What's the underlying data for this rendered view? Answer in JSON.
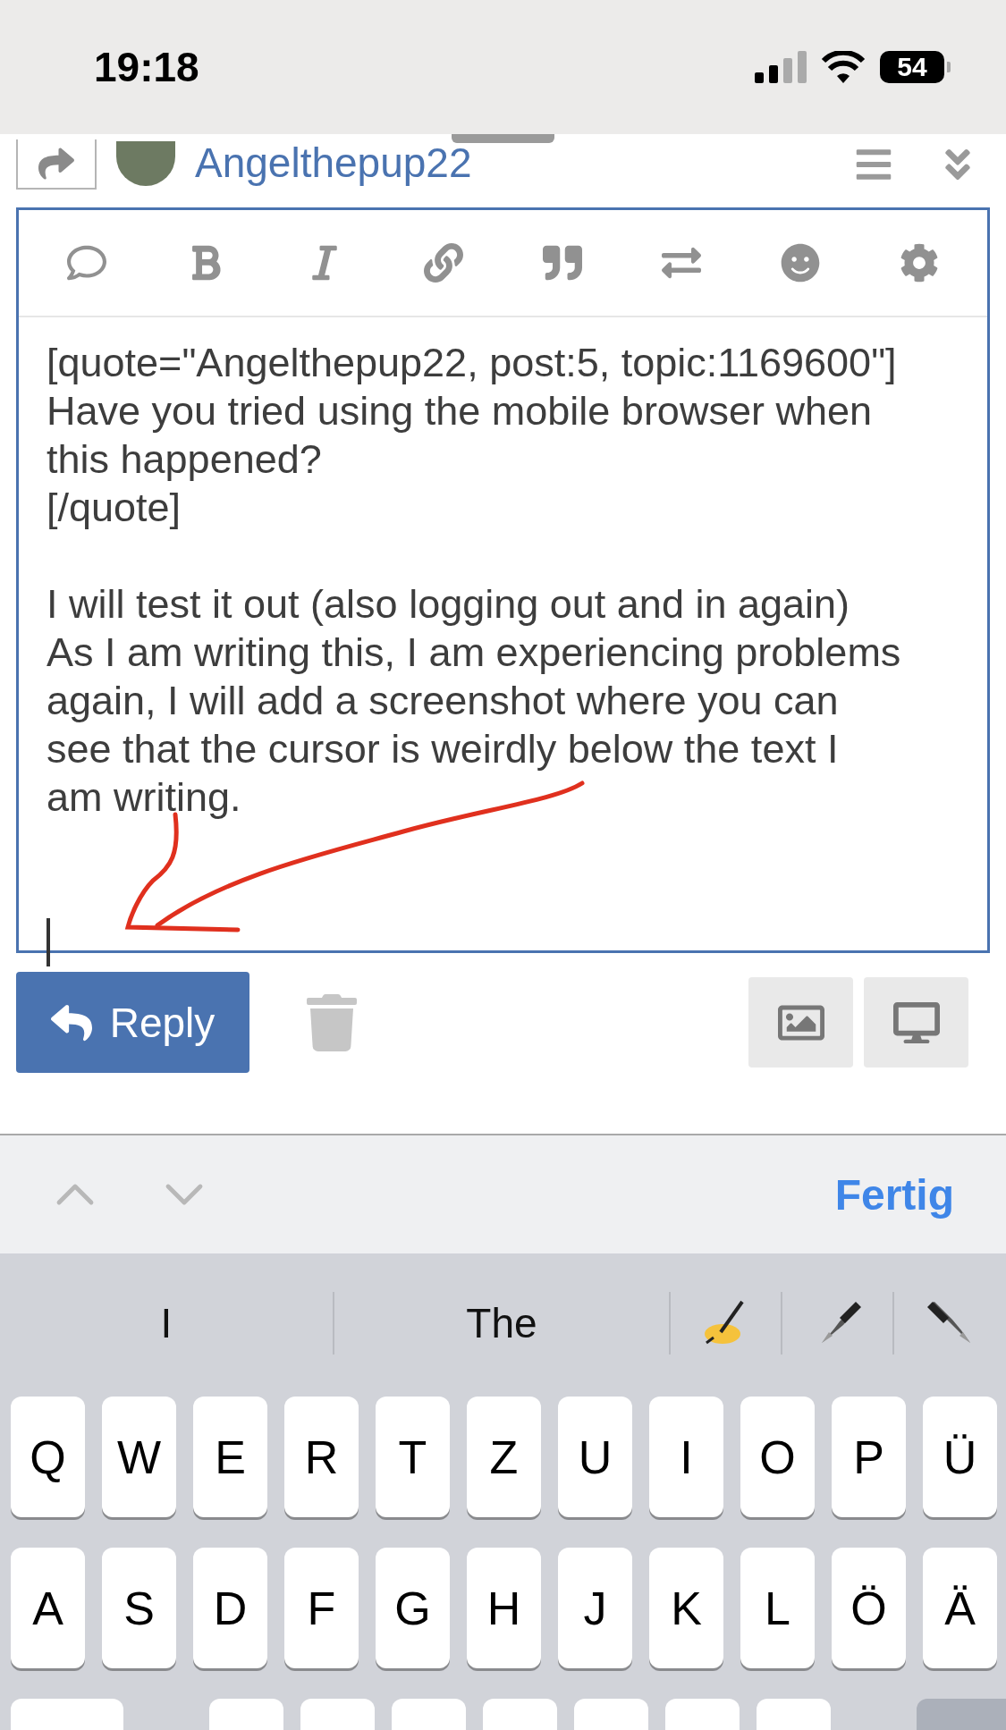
{
  "status_bar": {
    "time": "19:18",
    "battery": "54"
  },
  "header": {
    "username": "Angelthepup22"
  },
  "editor": {
    "paragraphs": [
      [
        "[quote=\"Angelthepup22, post:5, topic:1169600\"]",
        "Have you tried using the mobile browser when",
        "this happened?",
        "[/quote]"
      ],
      [
        "I will test it out (also logging out and in again)",
        "As I am writing this, I am experiencing problems",
        "again, I will add a screenshot where you can",
        "see that the cursor is weirdly below the text I",
        "am writing."
      ]
    ]
  },
  "actions": {
    "reply_label": "Reply"
  },
  "accessory_bar": {
    "done_label": "Fertig"
  },
  "keyboard": {
    "suggestions": [
      "I",
      "The"
    ],
    "rows": [
      [
        "Q",
        "W",
        "E",
        "R",
        "T",
        "Z",
        "U",
        "I",
        "O",
        "P",
        "Ü"
      ],
      [
        "A",
        "S",
        "D",
        "F",
        "G",
        "H",
        "J",
        "K",
        "L",
        "Ö",
        "Ä"
      ]
    ]
  }
}
